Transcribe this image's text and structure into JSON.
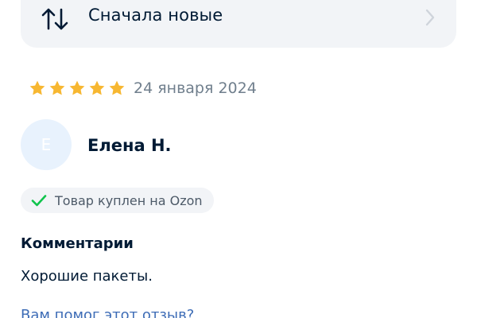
{
  "sort": {
    "label": "Сначала новые",
    "icon": "sort-arrows-icon",
    "chevron": "chevron-right-icon"
  },
  "review": {
    "rating": 5,
    "rating_max": 5,
    "date": "24 января 2024",
    "star_color": "#f7b731",
    "author": {
      "initial": "Е",
      "name": "Елена Н."
    },
    "badge": {
      "text": "Товар куплен на Ozon",
      "check_color": "#10c44c"
    },
    "comment_heading": "Комментарии",
    "comment_text": "Хорошие пакеты.",
    "helpful_question": "Вам помог этот отзыв?"
  },
  "colors": {
    "primary_text": "#001a34",
    "secondary_text": "#707f8d",
    "surface": "#f2f4f7",
    "link": "#3d6cb6",
    "avatar_bg": "#e8f2fd"
  }
}
